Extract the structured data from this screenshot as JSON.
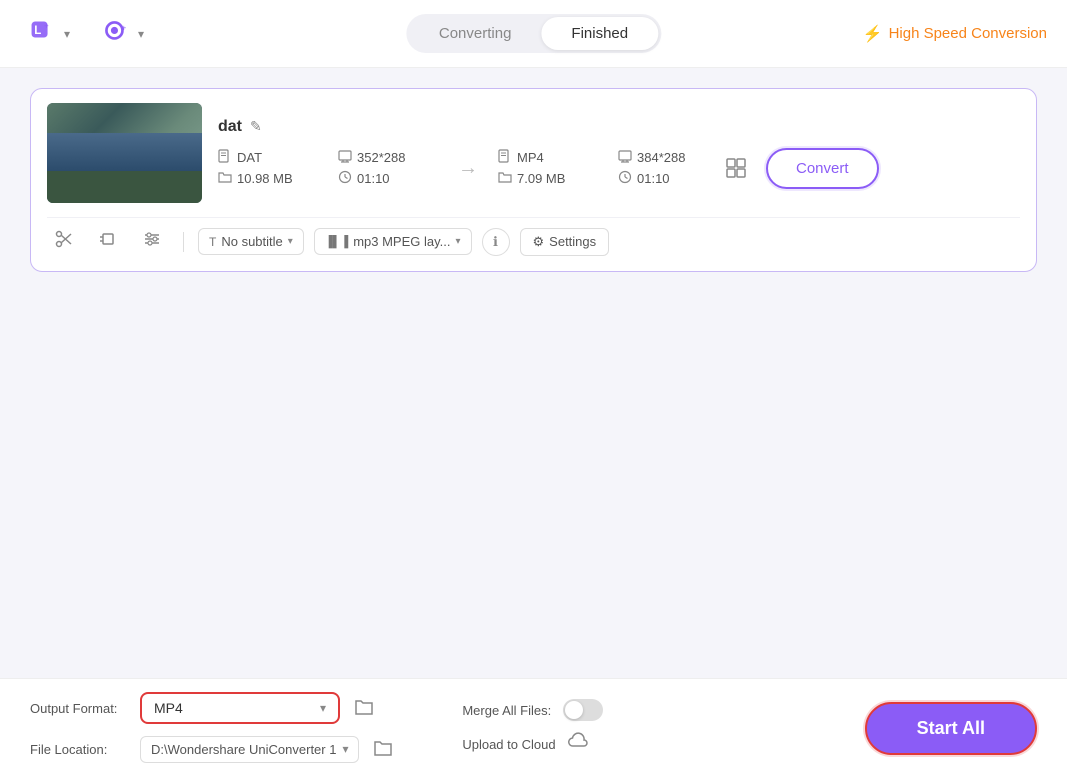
{
  "header": {
    "logo1_label": "L+",
    "logo1_dropdown": "▾",
    "logo2_label": "◎+",
    "logo2_dropdown": "▾",
    "tab_converting": "Converting",
    "tab_finished": "Finished",
    "high_speed_label": "High Speed Conversion",
    "bolt": "⚡"
  },
  "file_card": {
    "file_name": "dat",
    "edit_icon": "✎",
    "source": {
      "format": "DAT",
      "resolution": "352*288",
      "size": "10.98 MB",
      "duration": "01:10"
    },
    "target": {
      "format": "MP4",
      "resolution": "384*288",
      "size": "7.09 MB",
      "duration": "01:10"
    },
    "convert_label": "Convert",
    "subtitle_label": "No subtitle",
    "audio_label": "mp3 MPEG lay...",
    "settings_label": "Settings"
  },
  "bottom_bar": {
    "output_format_label": "Output Format:",
    "output_format_value": "MP4",
    "file_location_label": "File Location:",
    "file_location_value": "D:\\Wondershare UniConverter 1",
    "merge_label": "Merge All Files:",
    "upload_label": "Upload to Cloud",
    "start_all_label": "Start All",
    "folder_icon": "📁",
    "cloud_icon": "☁",
    "chevron_down": "▾",
    "gear_icon": "⚙"
  }
}
